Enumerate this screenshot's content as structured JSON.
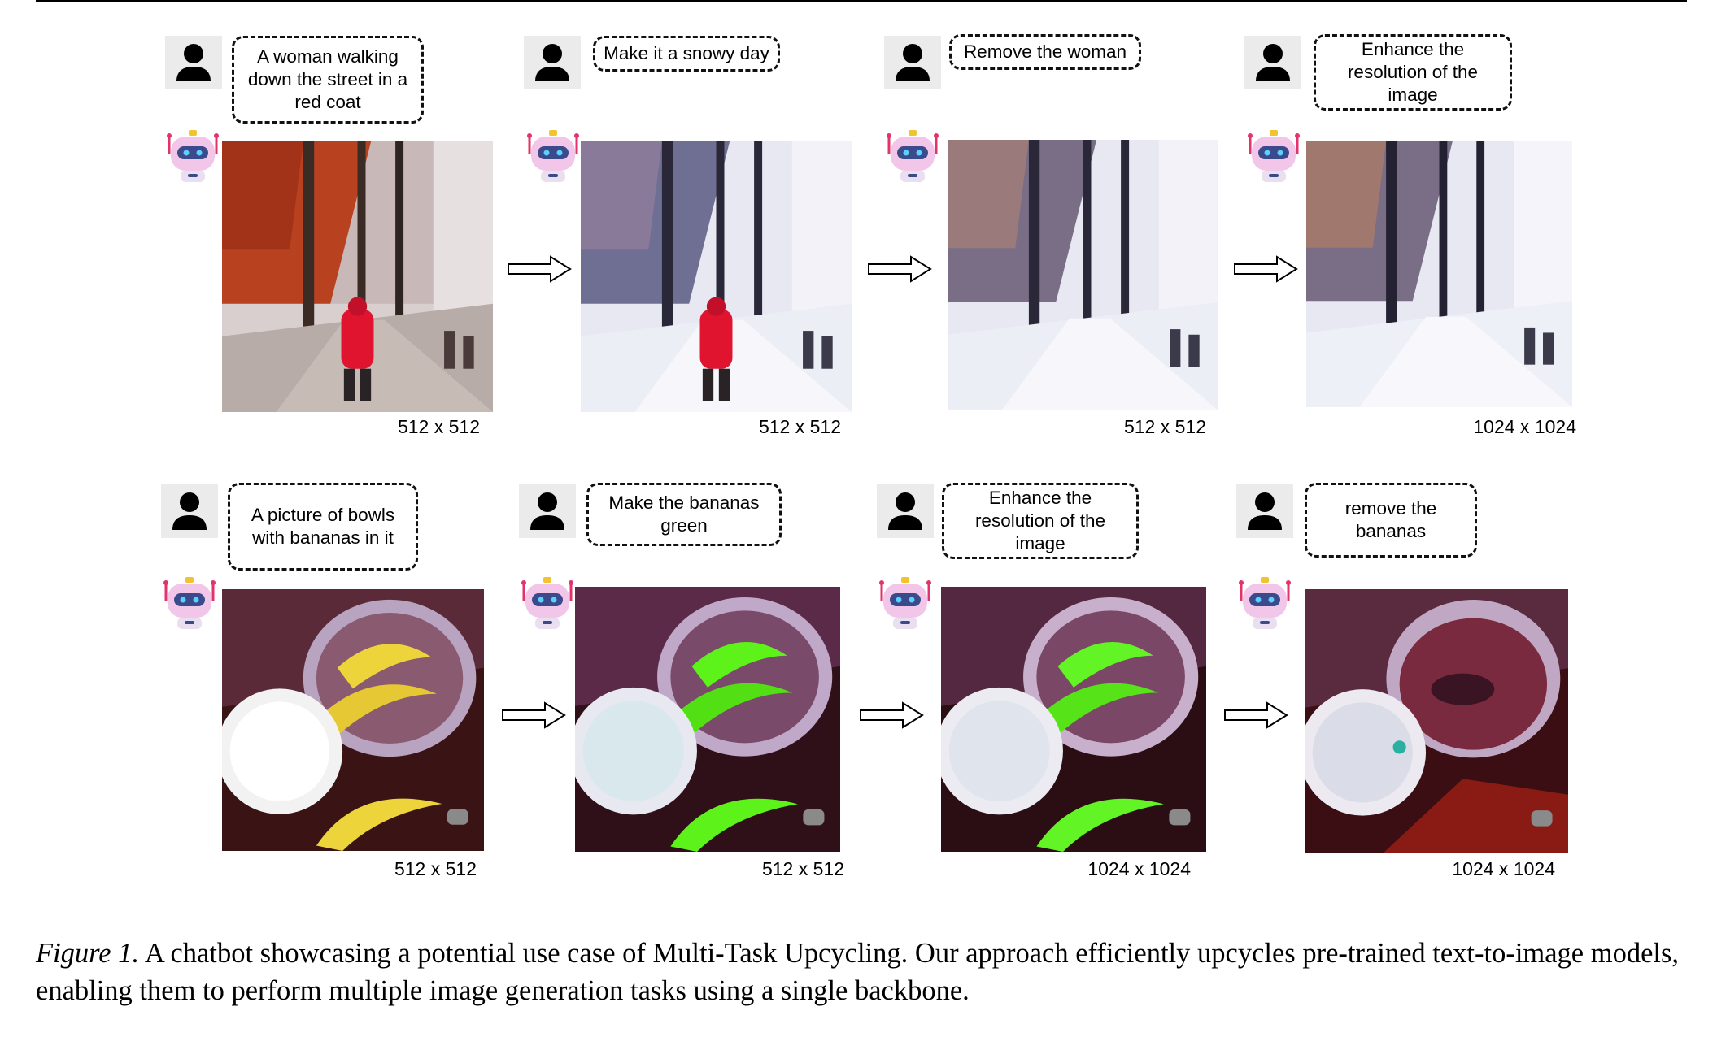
{
  "figure": {
    "rows": [
      {
        "steps": [
          {
            "prompt": "A woman walking down the street in a red coat",
            "resolution": "512 x 512"
          },
          {
            "prompt": "Make it a snowy day",
            "resolution": "512 x 512"
          },
          {
            "prompt": "Remove the woman",
            "resolution": "512 x 512"
          },
          {
            "prompt": "Enhance the resolution of the image",
            "resolution": "1024 x 1024"
          }
        ]
      },
      {
        "steps": [
          {
            "prompt": "A picture of bowls with bananas in it",
            "resolution": "512 x 512"
          },
          {
            "prompt": "Make the bananas green",
            "resolution": "512 x 512"
          },
          {
            "prompt": "Enhance the resolution of the image",
            "resolution": "1024 x 1024"
          },
          {
            "prompt": "remove the bananas",
            "resolution": "1024 x 1024"
          }
        ]
      }
    ]
  },
  "caption": {
    "label": "Figure 1.",
    "text": " A chatbot showcasing a potential use case of Multi-Task Upcycling. Our approach efficiently upcycles pre-trained text-to-image models, enabling them to perform multiple image generation tasks using a single backbone."
  },
  "colors": {
    "coat_red": "#e0142e",
    "foliage_red": "#b8421f",
    "banana_yellow": "#ecd43a",
    "banana_green": "#5cf21a",
    "robot_pink": "#f2c6e8",
    "robot_visor": "#3a4a8a"
  },
  "icons": [
    "user-icon",
    "robot-icon",
    "right-arrow-icon"
  ]
}
